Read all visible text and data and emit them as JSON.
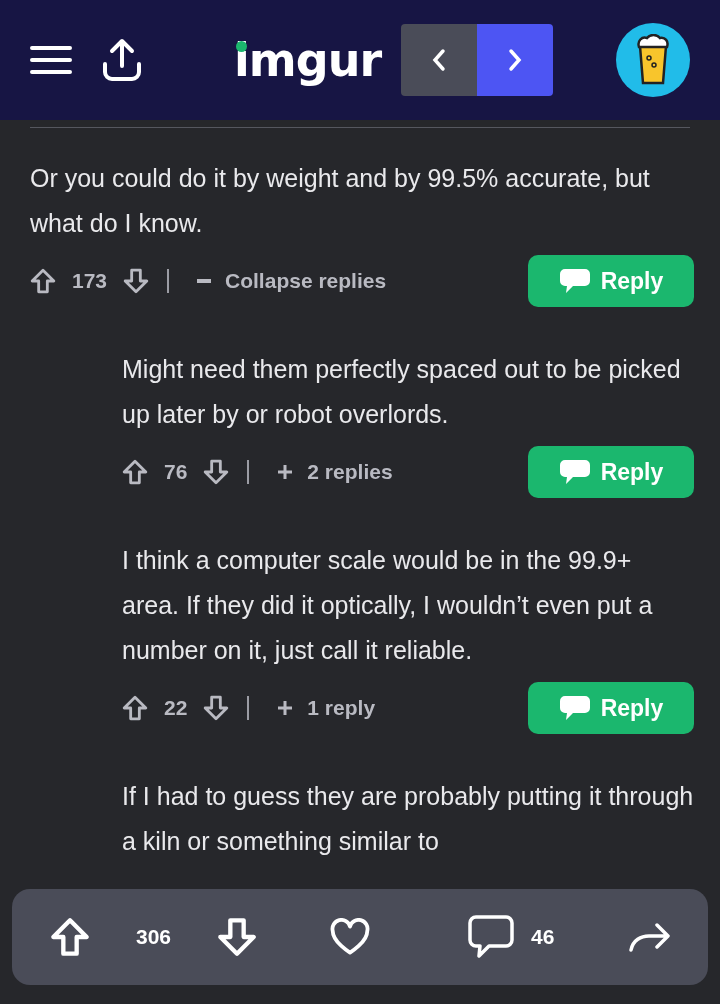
{
  "header": {
    "logo": "imgur",
    "nav": {
      "prev_selected": false,
      "next_selected": true
    }
  },
  "comments": [
    {
      "text": "Or you could do it by weight and by 99.5% accurate, but what do I know.",
      "votes": "173",
      "expanded": true,
      "toggle_label": "Collapse replies",
      "reply_label": "Reply",
      "children": [
        {
          "text": "Might need them perfectly spaced out to be picked up later by or robot overlords.",
          "votes": "76",
          "expanded": false,
          "toggle_label": "2 replies",
          "reply_label": "Reply"
        },
        {
          "text": "I think a computer scale would be in the 99.9+ area. If they did it optically, I wouldn’t even put a number on it, just call it reliable.",
          "votes": "22",
          "expanded": false,
          "toggle_label": "1 reply",
          "reply_label": "Reply"
        },
        {
          "text": "If I had to guess they are probably putting it through a kiln or something similar to"
        }
      ]
    }
  ],
  "action_bar": {
    "upvotes": "306",
    "comments": "46"
  }
}
